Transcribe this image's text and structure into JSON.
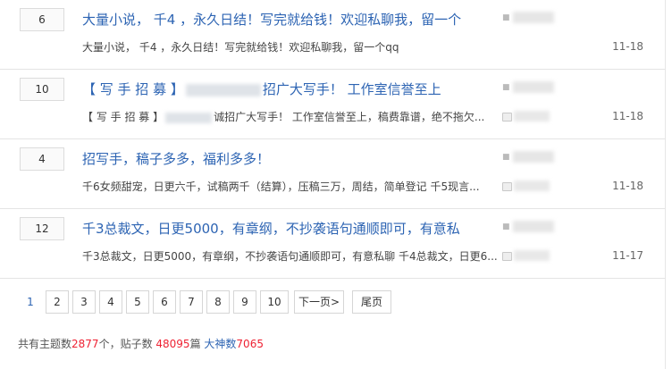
{
  "threads": [
    {
      "replies": "6",
      "title_a": "大量小说， 千4 ，永久日结！写完就给钱！欢迎私聊我，留一个",
      "title_b": "",
      "excerpt_a": "大量小说， 千4 ，永久日结！写完就给钱！欢迎私聊我，留一个qq",
      "excerpt_b": "",
      "date": "11-18"
    },
    {
      "replies": "10",
      "title_a": "【 写 手 招 募 】",
      "title_b": "招广大写手！ 工作室信誉至上",
      "excerpt_a": "【 写 手 招 募 】",
      "excerpt_b": "诚招广大写手！ 工作室信誉至上，稿费靠谱，绝不拖欠...",
      "date": "11-18"
    },
    {
      "replies": "4",
      "title_a": "招写手，稿子多多，福利多多！",
      "title_b": "",
      "excerpt_a": "千6女频甜宠，日更六千，试稿两千（结算），压稿三万，周结，简单登记 千5现言...",
      "excerpt_b": "",
      "date": "11-18"
    },
    {
      "replies": "12",
      "title_a": "千3总裁文，日更5000，有章纲，不抄袭语句通顺即可，有意私",
      "title_b": "",
      "excerpt_a": "千3总裁文，日更5000，有章纲，不抄袭语句通顺即可，有意私聊 千4总裁文，日更6...",
      "excerpt_b": "",
      "date": "11-17"
    }
  ],
  "pagination": {
    "pages": [
      "1",
      "2",
      "3",
      "4",
      "5",
      "6",
      "7",
      "8",
      "9",
      "10"
    ],
    "next": "下一页>",
    "last": "尾页"
  },
  "stats": {
    "label_topics": "共有主题数",
    "topics": "2877",
    "unit_topics": "个，贴子数 ",
    "posts": "48095",
    "unit_posts": "篇 ",
    "label_gods": "大神数",
    "gods": "7065"
  }
}
